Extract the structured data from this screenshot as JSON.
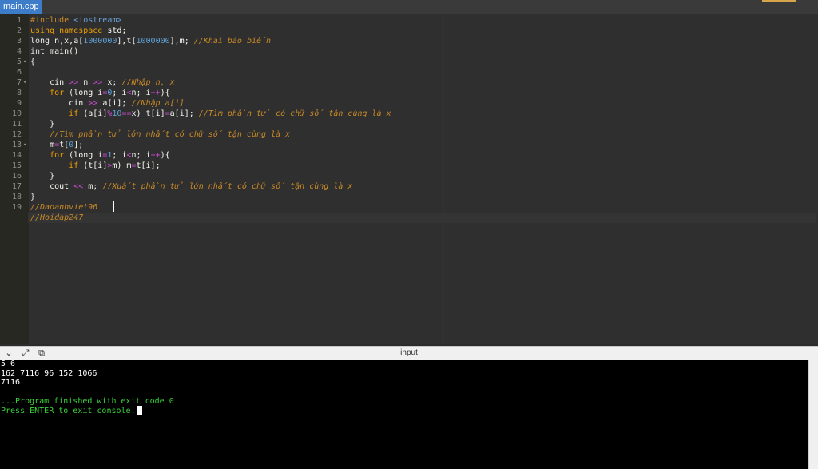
{
  "tab": {
    "label": "main.cpp"
  },
  "editor": {
    "line_numbers": [
      "1",
      "2",
      "3",
      "4",
      "5",
      "6",
      "7",
      "8",
      "9",
      "10",
      "11",
      "12",
      "13",
      "14",
      "15",
      "16",
      "17",
      "18",
      "19"
    ],
    "fold_markers": [
      "5",
      "7",
      "13"
    ],
    "lines": [
      [
        {
          "t": "#include ",
          "c": "pp"
        },
        {
          "t": "<iostream>",
          "c": "inc"
        }
      ],
      [
        {
          "t": "using ",
          "c": "kw"
        },
        {
          "t": "namespace ",
          "c": "kw"
        },
        {
          "t": "std;",
          "c": ""
        }
      ],
      [
        {
          "t": "long ",
          "c": "ty"
        },
        {
          "t": "n,x,a[",
          "c": ""
        },
        {
          "t": "1000000",
          "c": "nm"
        },
        {
          "t": "],t[",
          "c": ""
        },
        {
          "t": "1000000",
          "c": "nm"
        },
        {
          "t": "],m; ",
          "c": ""
        },
        {
          "t": "//Khai báo biến",
          "c": "cm"
        }
      ],
      [
        {
          "t": "int ",
          "c": "ty"
        },
        {
          "t": "main()",
          "c": ""
        }
      ],
      [
        {
          "t": "{",
          "c": ""
        }
      ],
      [
        {
          "t": "",
          "c": ""
        }
      ],
      [
        {
          "t": "    cin ",
          "c": ""
        },
        {
          "t": ">>",
          "c": "op"
        },
        {
          "t": " n ",
          "c": ""
        },
        {
          "t": ">>",
          "c": "op"
        },
        {
          "t": " x; ",
          "c": ""
        },
        {
          "t": "//Nhập n, x",
          "c": "cm"
        }
      ],
      [
        {
          "t": "    ",
          "c": ""
        },
        {
          "t": "for",
          "c": "kw"
        },
        {
          "t": " (long i",
          "c": ""
        },
        {
          "t": "=",
          "c": "op"
        },
        {
          "t": "0",
          "c": "nm"
        },
        {
          "t": "; i",
          "c": ""
        },
        {
          "t": "<",
          "c": "op"
        },
        {
          "t": "n; i",
          "c": ""
        },
        {
          "t": "++",
          "c": "op"
        },
        {
          "t": "){",
          "c": ""
        }
      ],
      [
        {
          "t": "        cin ",
          "c": ""
        },
        {
          "t": ">>",
          "c": "op"
        },
        {
          "t": " a[i]; ",
          "c": ""
        },
        {
          "t": "//Nhập a[i]",
          "c": "cm"
        }
      ],
      [
        {
          "t": "        ",
          "c": ""
        },
        {
          "t": "if",
          "c": "kw"
        },
        {
          "t": " (a[i]",
          "c": ""
        },
        {
          "t": "%",
          "c": "op"
        },
        {
          "t": "10",
          "c": "nm"
        },
        {
          "t": "==",
          "c": "op"
        },
        {
          "t": "x) t[i]",
          "c": ""
        },
        {
          "t": "=",
          "c": "op"
        },
        {
          "t": "a[i]; ",
          "c": ""
        },
        {
          "t": "//Tìm phần tử có chữ số tận cùng là x",
          "c": "cm"
        }
      ],
      [
        {
          "t": "    }",
          "c": ""
        }
      ],
      [
        {
          "t": "    ",
          "c": ""
        },
        {
          "t": "//Tìm phần tử lớn nhất có chữ số tận cùng là x",
          "c": "cm"
        }
      ],
      [
        {
          "t": "    m",
          "c": ""
        },
        {
          "t": "=",
          "c": "op"
        },
        {
          "t": "t[",
          "c": ""
        },
        {
          "t": "0",
          "c": "nm"
        },
        {
          "t": "];",
          "c": ""
        }
      ],
      [
        {
          "t": "    ",
          "c": ""
        },
        {
          "t": "for",
          "c": "kw"
        },
        {
          "t": " (long i",
          "c": ""
        },
        {
          "t": "=",
          "c": "op"
        },
        {
          "t": "1",
          "c": "nm"
        },
        {
          "t": "; i",
          "c": ""
        },
        {
          "t": "<",
          "c": "op"
        },
        {
          "t": "n; i",
          "c": ""
        },
        {
          "t": "++",
          "c": "op"
        },
        {
          "t": "){",
          "c": ""
        }
      ],
      [
        {
          "t": "        ",
          "c": ""
        },
        {
          "t": "if",
          "c": "kw"
        },
        {
          "t": " (t[i]",
          "c": ""
        },
        {
          "t": ">",
          "c": "op"
        },
        {
          "t": "m) m",
          "c": ""
        },
        {
          "t": "=",
          "c": "op"
        },
        {
          "t": "t[i];",
          "c": ""
        }
      ],
      [
        {
          "t": "    }",
          "c": ""
        }
      ],
      [
        {
          "t": "    cout ",
          "c": ""
        },
        {
          "t": "<<",
          "c": "op"
        },
        {
          "t": " m; ",
          "c": ""
        },
        {
          "t": "//Xuất phần tử lớn nhất có chữ số tận cùng là x",
          "c": "cm"
        }
      ],
      [
        {
          "t": "}",
          "c": ""
        }
      ],
      [
        {
          "t": "//Daoanhviet96",
          "c": "cm"
        }
      ],
      [
        {
          "t": "//Hoidap247",
          "c": "cm"
        }
      ]
    ]
  },
  "console": {
    "title": "input",
    "icons": [
      "chevron-down-icon",
      "expand-icon",
      "copy-icon"
    ],
    "output": [
      {
        "text": "5 6",
        "color": "white"
      },
      {
        "text": "162 7116 96 152 1066",
        "color": "white"
      },
      {
        "text": "7116",
        "color": "white"
      },
      {
        "text": "",
        "color": "white"
      },
      {
        "text": "...Program finished with exit code 0",
        "color": "green"
      },
      {
        "text": "Press ENTER to exit console.",
        "color": "green"
      }
    ]
  }
}
